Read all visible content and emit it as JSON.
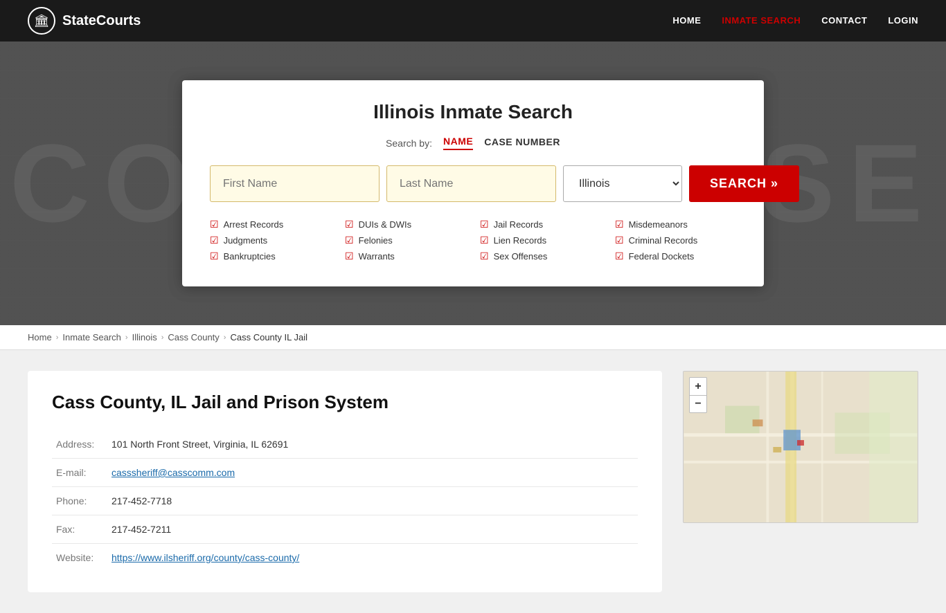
{
  "site": {
    "logo_text": "StateCourts",
    "logo_icon": "🏛"
  },
  "nav": {
    "items": [
      {
        "label": "HOME",
        "href": "#",
        "active": false
      },
      {
        "label": "INMATE SEARCH",
        "href": "#",
        "active": true
      },
      {
        "label": "CONTACT",
        "href": "#",
        "active": false
      },
      {
        "label": "LOGIN",
        "href": "#",
        "active": false
      }
    ]
  },
  "hero_bg_text": "COURTHOUSE",
  "search_card": {
    "title": "Illinois Inmate Search",
    "search_by_label": "Search by:",
    "search_by_options": [
      {
        "label": "NAME",
        "active": true
      },
      {
        "label": "CASE NUMBER",
        "active": false
      }
    ],
    "first_name_placeholder": "First Name",
    "last_name_placeholder": "Last Name",
    "state_value": "Illinois",
    "search_button_label": "SEARCH »",
    "checkboxes": [
      {
        "label": "Arrest Records"
      },
      {
        "label": "DUIs & DWIs"
      },
      {
        "label": "Jail Records"
      },
      {
        "label": "Misdemeanors"
      },
      {
        "label": "Judgments"
      },
      {
        "label": "Felonies"
      },
      {
        "label": "Lien Records"
      },
      {
        "label": "Criminal Records"
      },
      {
        "label": "Bankruptcies"
      },
      {
        "label": "Warrants"
      },
      {
        "label": "Sex Offenses"
      },
      {
        "label": "Federal Dockets"
      }
    ]
  },
  "breadcrumb": {
    "items": [
      {
        "label": "Home",
        "href": "#"
      },
      {
        "label": "Inmate Search",
        "href": "#"
      },
      {
        "label": "Illinois",
        "href": "#"
      },
      {
        "label": "Cass County",
        "href": "#"
      },
      {
        "label": "Cass County IL Jail",
        "current": true
      }
    ]
  },
  "jail_info": {
    "title": "Cass County, IL Jail and Prison System",
    "fields": [
      {
        "label": "Address:",
        "value": "101 North Front Street, Virginia, IL 62691",
        "type": "text"
      },
      {
        "label": "E-mail:",
        "value": "casssheriff@casscomm.com",
        "type": "email"
      },
      {
        "label": "Phone:",
        "value": "217-452-7718",
        "type": "text"
      },
      {
        "label": "Fax:",
        "value": "217-452-7211",
        "type": "text"
      },
      {
        "label": "Website:",
        "value": "https://www.ilsheriff.org/county/cass-county/",
        "type": "url"
      }
    ]
  },
  "map": {
    "zoom_in": "+",
    "zoom_out": "−"
  },
  "colors": {
    "accent": "#cc0000",
    "link": "#1a6aaa"
  }
}
